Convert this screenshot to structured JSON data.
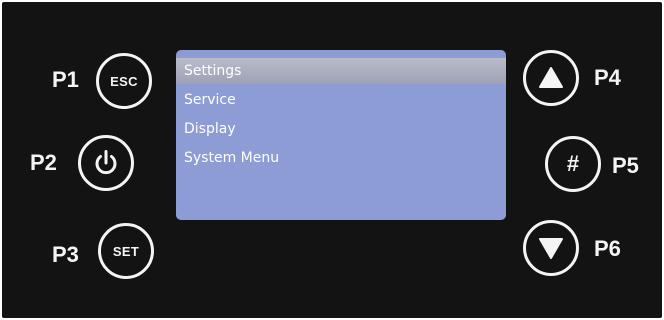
{
  "panel": {
    "buttons": {
      "p1": {
        "label": "P1",
        "text": "ESC"
      },
      "p2": {
        "label": "P2"
      },
      "p3": {
        "label": "P3",
        "text": "SET"
      },
      "p4": {
        "label": "P4"
      },
      "p5": {
        "label": "P5",
        "text": "#"
      },
      "p6": {
        "label": "P6"
      }
    }
  },
  "screen": {
    "menu": [
      {
        "label": "Settings",
        "selected": true
      },
      {
        "label": "Service"
      },
      {
        "label": "Display"
      },
      {
        "label": "System Menu"
      }
    ]
  },
  "icons": {
    "p2": "power-icon",
    "p4": "arrow-up-icon",
    "p6": "arrow-down-icon"
  },
  "colors": {
    "panel": "#131313",
    "screen": "#8e9cd6",
    "selection": "#a9adc0",
    "foreground": "#f4f4f4"
  }
}
